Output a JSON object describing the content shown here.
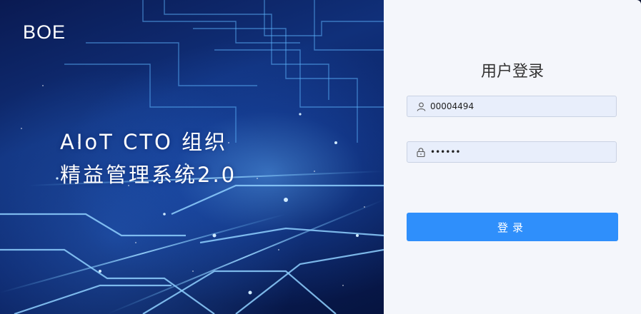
{
  "brand": {
    "logo_text": "BOE"
  },
  "hero": {
    "title_line1": "AIoT CTO 组织",
    "title_line2": "精益管理系统2.0"
  },
  "login": {
    "title": "用户登录",
    "username_value": "00004494",
    "password_value": "000000",
    "submit_label": "登录"
  },
  "icons": {
    "username": "user-icon",
    "password": "lock-icon"
  },
  "colors": {
    "primary_button": "#2f8ffb",
    "input_bg": "#e8eefb",
    "panel_bg": "#f4f6fb"
  }
}
